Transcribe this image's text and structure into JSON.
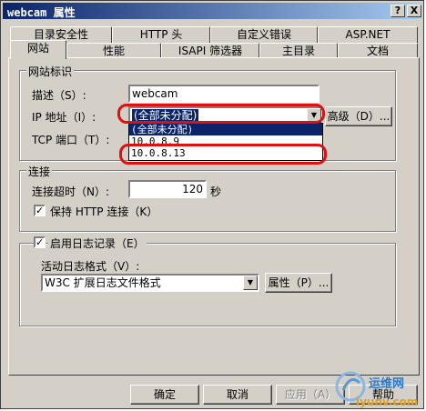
{
  "window": {
    "title": "webcam 属性",
    "help_glyph": "?",
    "close_glyph": "X"
  },
  "tabs_row1": [
    "目录安全性",
    "HTTP 头",
    "自定义错误",
    "ASP.NET"
  ],
  "tabs_row2": [
    "网站",
    "性能",
    "ISAPI 筛选器",
    "主目录",
    "文档"
  ],
  "site_id": {
    "group_label": "网站标识",
    "description_label": "描述（S）:",
    "description_value": "webcam",
    "ip_label": "IP 地址（I）:",
    "ip_value": "(全部未分配)",
    "ip_options": [
      "(全部未分配)",
      "10.0.8.9",
      "10.0.8.13"
    ],
    "ip_selected_index": 0,
    "tcp_label": "TCP 端口（T）:",
    "advanced_button": "高级（D）..."
  },
  "connections": {
    "group_label": "连接",
    "timeout_label": "连接超时（N）:",
    "timeout_value": "120",
    "timeout_unit": "秒",
    "keepalive_label": "保持 HTTP 连接（K）",
    "keepalive_checked": true
  },
  "logging": {
    "enable_label": "启用日志记录（E）",
    "enable_checked": true,
    "format_label": "活动日志格式（V）:",
    "format_value": "W3C 扩展日志文件格式",
    "properties_button": "属性（P）..."
  },
  "buttons": {
    "ok": "确定",
    "cancel": "取消",
    "apply": "应用（A）",
    "help": "帮助"
  },
  "watermark": {
    "text1": "运维网",
    "text2": "iyunv.com"
  },
  "check_glyph": "✓",
  "arrow_glyph": "▼"
}
